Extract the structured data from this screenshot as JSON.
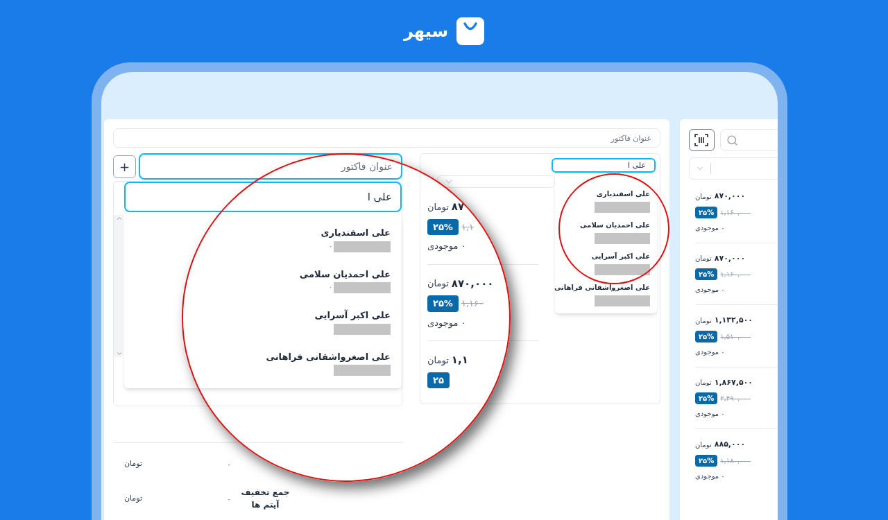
{
  "brand": {
    "name": "سیهر"
  },
  "invoice": {
    "title_field": {
      "placeholder": "عنوان فاکتور"
    },
    "magnified": {
      "add_button": "+",
      "title_field": {
        "placeholder": "عنوان فاکتور"
      },
      "customer_search": {
        "value": "علی ا"
      },
      "customers": [
        {
          "name": "علی اسفندیاری",
          "note": "۰"
        },
        {
          "name": "علی احمدیان سلامی",
          "note": "۰"
        },
        {
          "name": "علی اکبر آسرایی"
        },
        {
          "name": "علی اصغرواشقانی فراهانی"
        }
      ],
      "totals": [
        {
          "value": "۰",
          "unit": "تومان"
        },
        {
          "label": "جمع تخفیف آیتم ها",
          "value": "۰",
          "unit": "تومان"
        }
      ]
    },
    "customer_search": {
      "value": "علی ا"
    },
    "customers": [
      {
        "name": "علی اسفندیاری"
      },
      {
        "name": "علی احمدیان سلامی"
      },
      {
        "name": "علی اکبر آسرایی"
      },
      {
        "name": "علی اصغرواشقانی فراهانی"
      }
    ],
    "products": [
      {
        "price": "۸۷",
        "unit": "تومان",
        "discount": "۲۵%",
        "old_price": "۱,۱",
        "stock": "۰ موجودی"
      },
      {
        "price": "۸۷۰,۰۰۰",
        "unit": "تومان",
        "discount": "۲۵%",
        "old_price": "۱,۱۶۰",
        "stock": "۰ موجودی"
      },
      {
        "price": "۱,۱",
        "unit": "تومان",
        "discount": "۲۵"
      }
    ]
  },
  "catalog": {
    "products": [
      {
        "price": "۸۷۰,۰۰۰",
        "unit": "تومان",
        "discount": "۲۵%",
        "old_price": "۱,۱۶۰,۰۰۰",
        "stock": "۰ موجودی"
      },
      {
        "price": "۸۷۰,۰۰۰",
        "unit": "تومان",
        "discount": "۲۵%",
        "old_price": "۱,۱۶۰,۰۰۰",
        "stock": "۰ موجودی"
      },
      {
        "price": "۱,۱۳۲,۵۰۰",
        "unit": "تومان",
        "discount": "۲۵%",
        "old_price": "۱,۵۱۰,۰۰۰",
        "stock": "۰ موجودی"
      },
      {
        "price": "۱,۸۶۷,۵۰۰",
        "unit": "تومان",
        "discount": "۲۵%",
        "old_price": "۲,۴۹۰,۰۰۰",
        "stock": "۰ موجودی"
      },
      {
        "price": "۸۸۵,۰۰۰",
        "unit": "تومان",
        "discount": "۲۵%",
        "old_price": "۱,۱۸۰,۰۰۰",
        "stock": "۰ موجودی"
      }
    ]
  }
}
